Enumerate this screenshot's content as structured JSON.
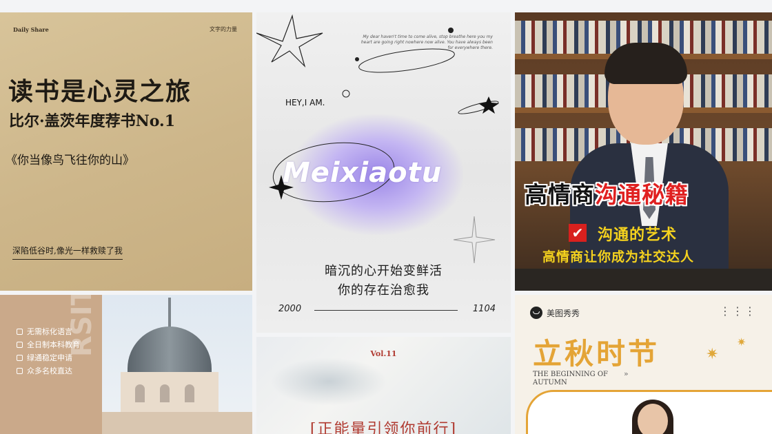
{
  "cards": {
    "reading": {
      "top_left": "Daily Share",
      "top_right": "文字的力量",
      "headline": "读书是心灵之旅",
      "subline": "比尔·盖茨年度荐书No.1",
      "book": "《你当像鸟飞往你的山》",
      "footer": "深陷低谷时,像光一样救赎了我"
    },
    "meixiaotu": {
      "small_text": "My dear haven't time to come alive, stop breathe here you my heart are going right nowhere now alive. You have always been for everywhere there.",
      "greeting": "HEY,I AM.",
      "brand": "Meixiaotu",
      "line1": "暗沉的心开始变鲜活",
      "line2": "你的存在治愈我",
      "year_start": "2000",
      "year_end": "1104"
    },
    "eq": {
      "title_black": "高情商",
      "title_red": "沟通秘籍",
      "check_icon": "✔",
      "art": "沟通的艺术",
      "desc": "高情商让你成为社交达人"
    },
    "edu": {
      "items": [
        "无需标化语言",
        "全日制本科教育",
        "绿通稳定申请",
        "众多名校直达"
      ],
      "vertical_text": "RSITY"
    },
    "vol": {
      "vol": "Vol.11",
      "slogan": "[正能量引领你前行]"
    },
    "autumn": {
      "brand": "美图秀秀",
      "more": "⋮⋮⋮",
      "title": "立秋时节",
      "en1": "THE BEGINNING OF",
      "en2": "AUTUMN",
      "arrows": "»",
      "leaf": "✷"
    }
  },
  "colors": {
    "accent_red": "#e02020",
    "accent_yellow": "#f5d21e",
    "autumn_orange": "#e4a436",
    "vol_red": "#b03a30"
  }
}
